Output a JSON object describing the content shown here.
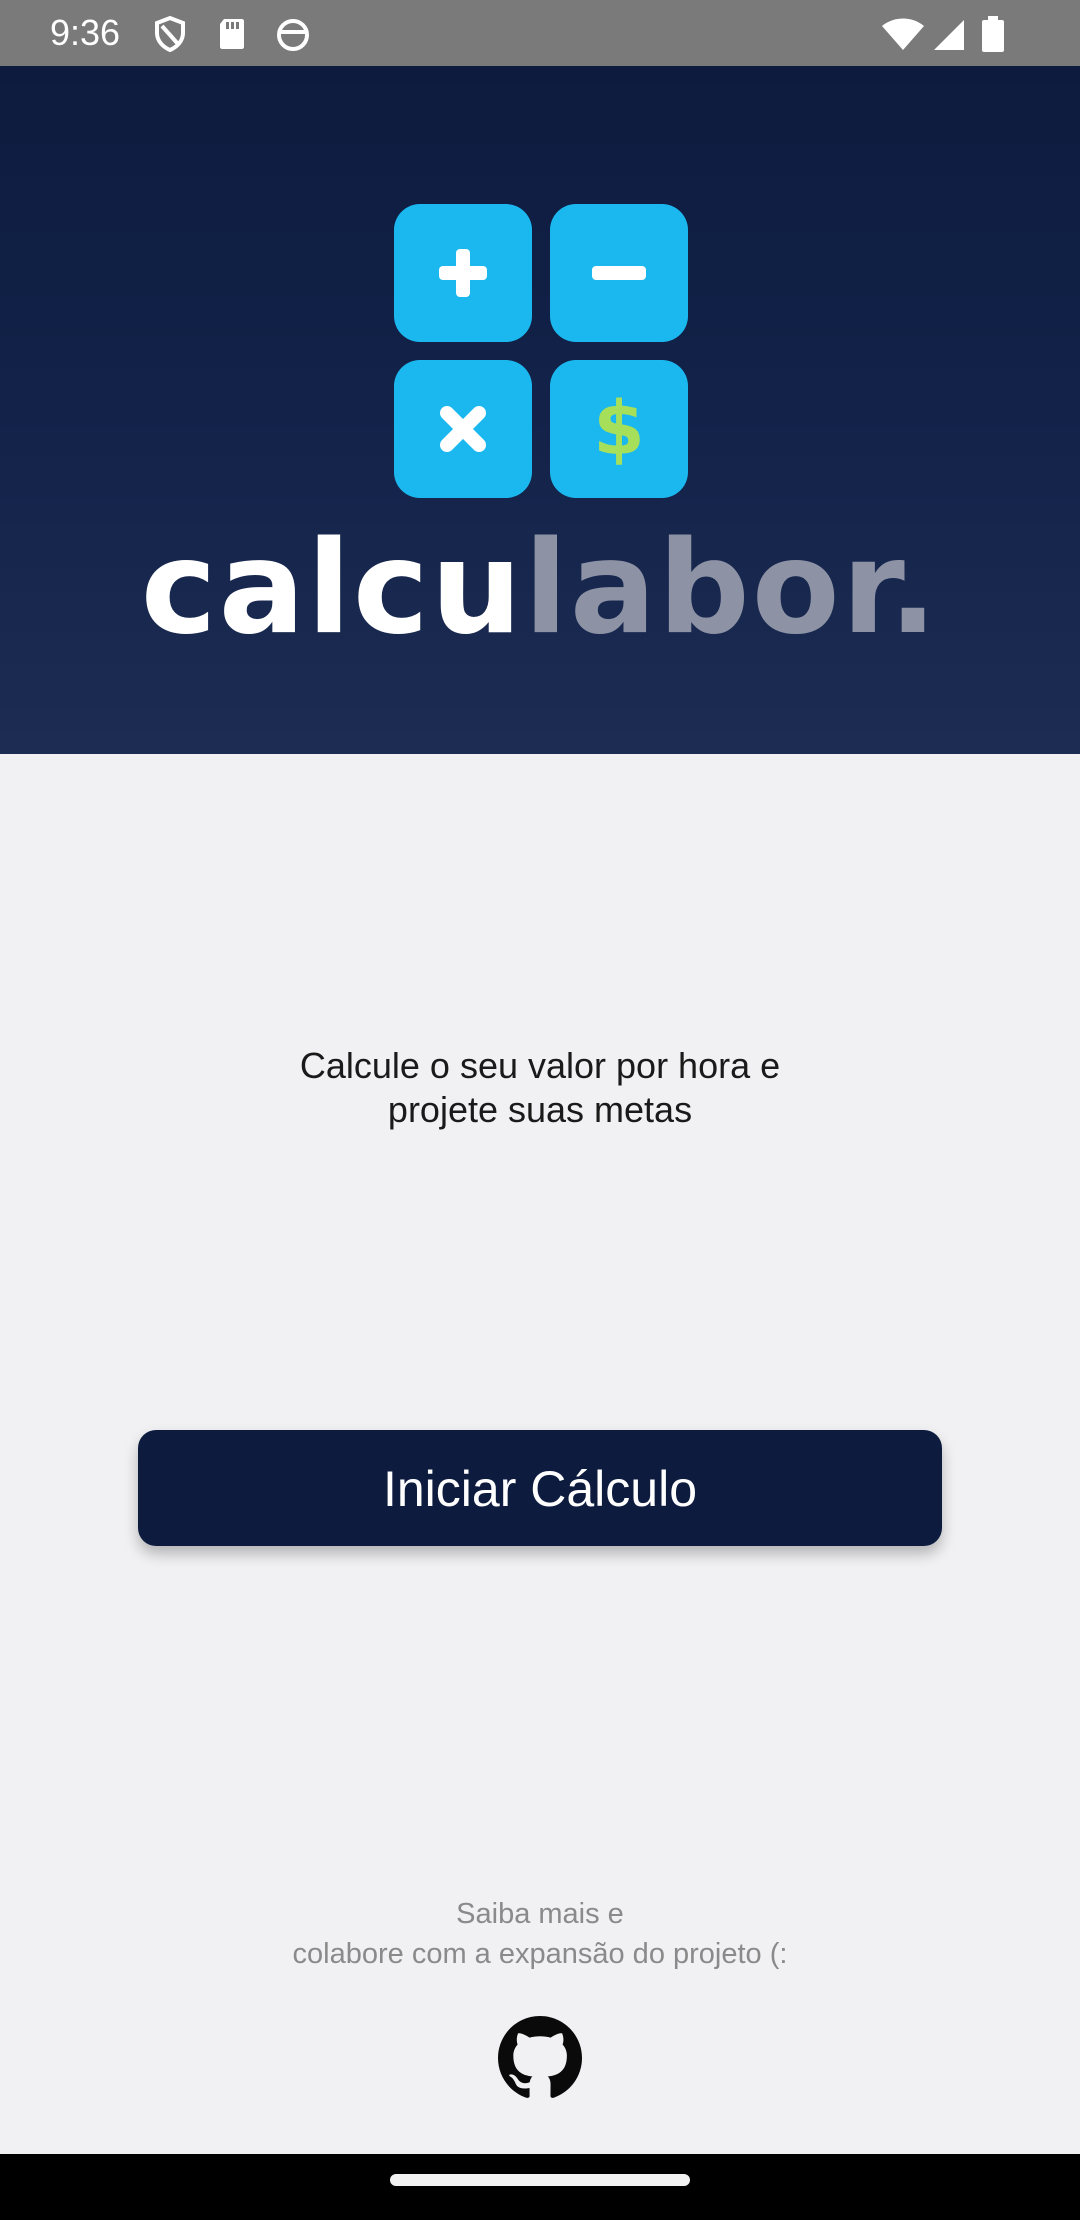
{
  "status_bar": {
    "time": "9:36",
    "left_icons": [
      "shield-icon",
      "sd-card-icon",
      "app-notification-icon"
    ],
    "right_icons": [
      "wifi-icon",
      "signal-icon",
      "battery-icon"
    ]
  },
  "header": {
    "logo_tiles": [
      "plus-icon",
      "minus-icon",
      "times-icon",
      "dollar-icon"
    ],
    "brand_part1": "calcu",
    "brand_part2": "labor.",
    "colors": {
      "background": "#0d1b3e",
      "tile": "#1bb8f0",
      "dollar": "#a6e05a",
      "brand_muted": "#8d93a5"
    }
  },
  "main": {
    "tagline_line1": "Calcule o seu valor por hora e",
    "tagline_line2": "projete suas metas",
    "start_button_label": "Iniciar Cálculo"
  },
  "footer": {
    "line1": "Saiba mais e",
    "line2": "colabore com a expansão do projeto (:",
    "link_icon": "github-icon"
  }
}
